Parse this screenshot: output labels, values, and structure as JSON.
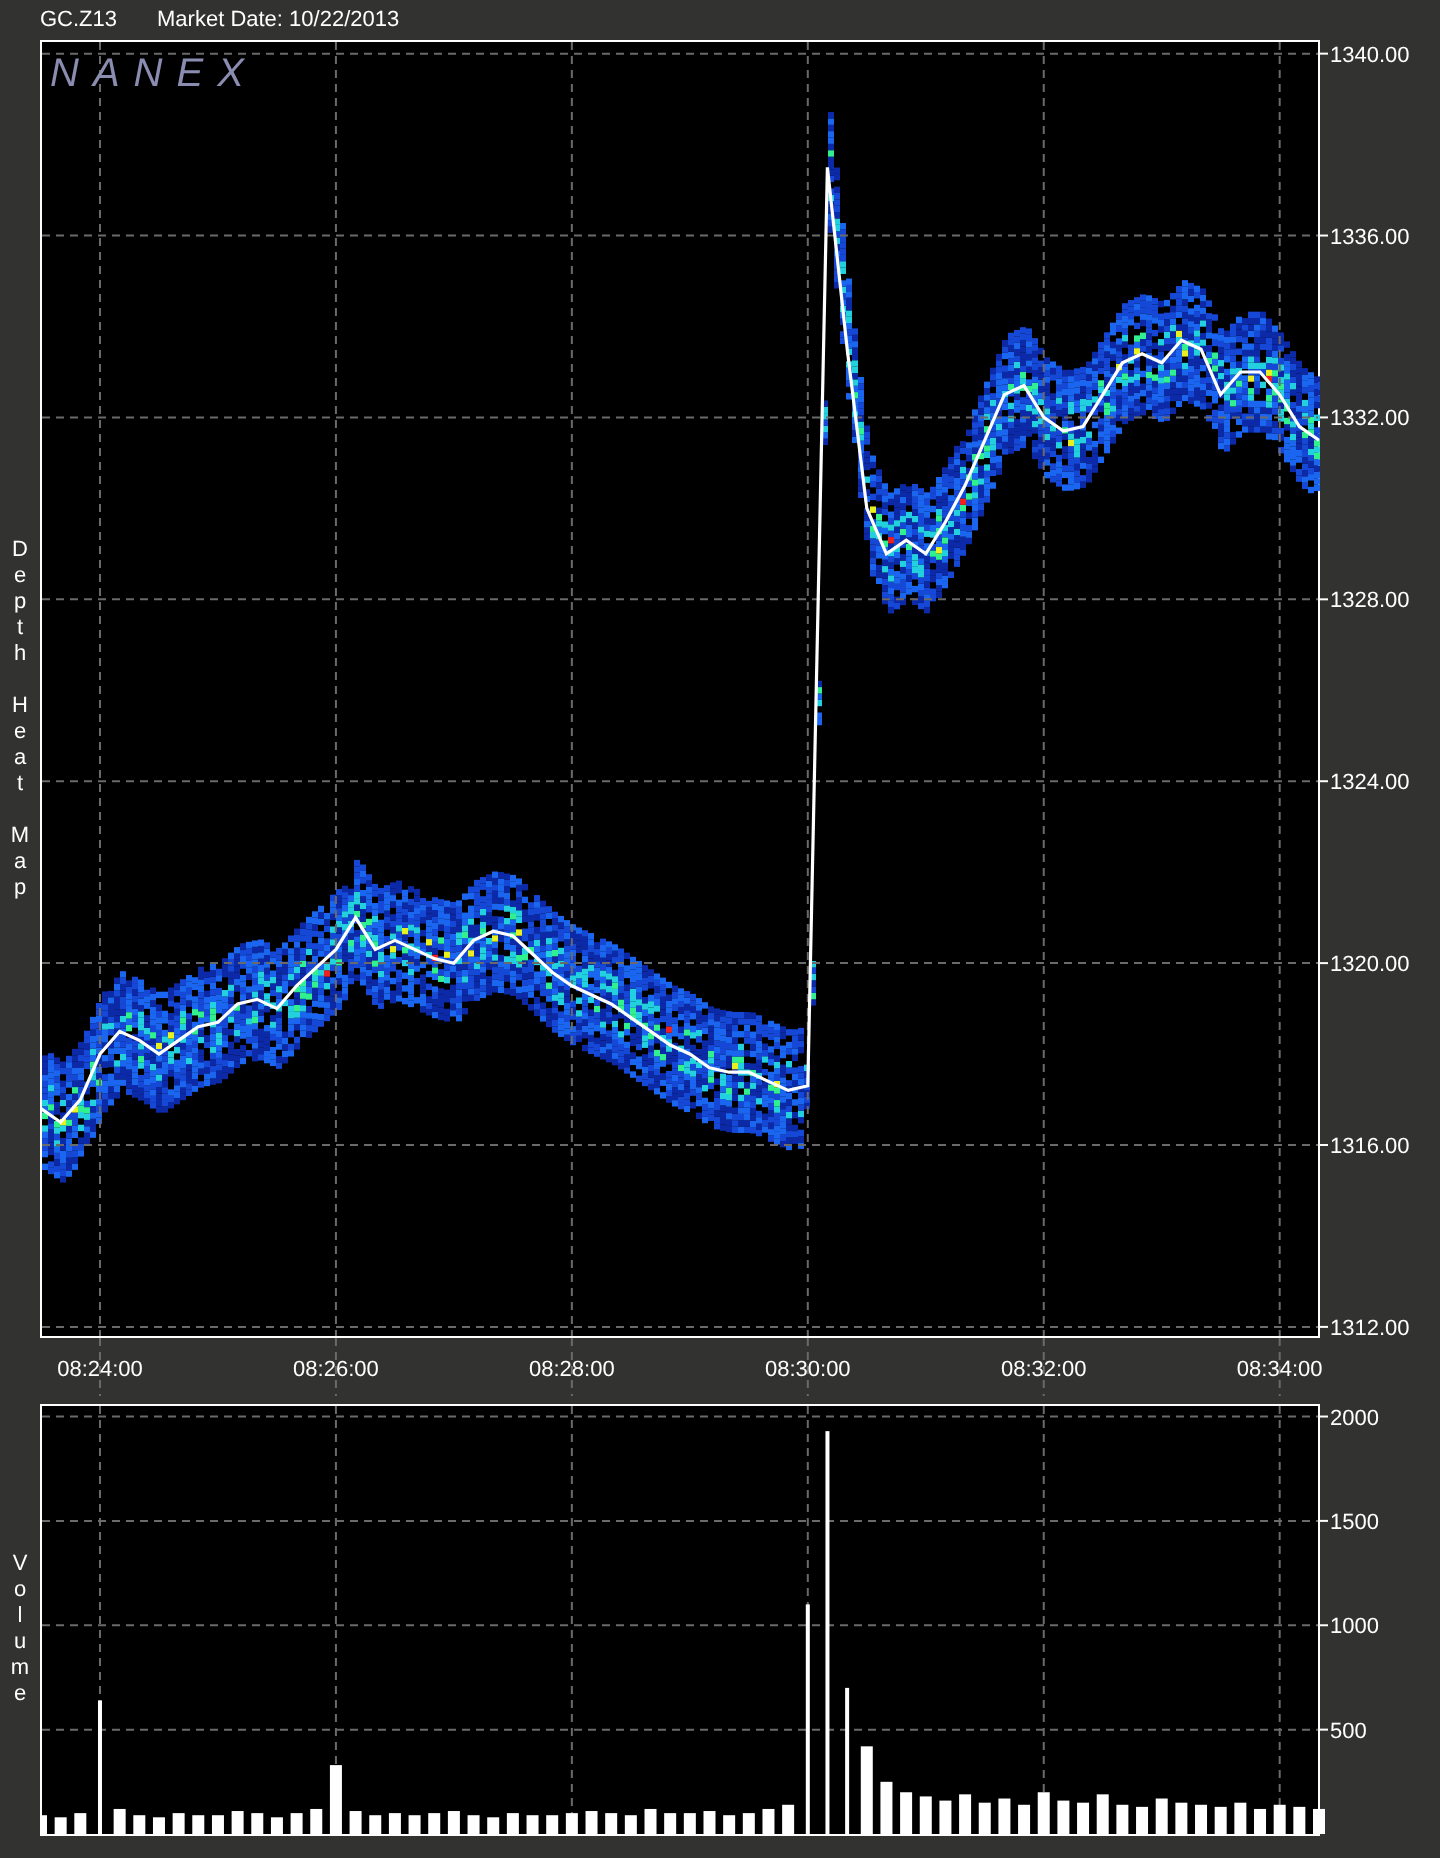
{
  "header": {
    "symbol": "GC.Z13",
    "market_date": "Market Date: 10/22/2013"
  },
  "price_panel": {
    "logo": "NANEX",
    "chart_data": {
      "type": "line",
      "ylabel": "Depth Heat Map",
      "grid": true,
      "ylim": [
        1311.8,
        1340.3
      ],
      "categories": [
        null,
        null,
        null,
        "08:24:00",
        null,
        null,
        null,
        null,
        null,
        null,
        null,
        null,
        null,
        null,
        null,
        "08:26:00",
        null,
        null,
        null,
        null,
        null,
        null,
        null,
        null,
        null,
        null,
        null,
        "08:28:00",
        null,
        null,
        null,
        null,
        null,
        null,
        null,
        null,
        null,
        null,
        null,
        "08:30:00",
        null,
        null,
        null,
        null,
        null,
        null,
        null,
        null,
        null,
        null,
        null,
        "08:32:00",
        null,
        null,
        null,
        null,
        null,
        null,
        null,
        null,
        null,
        null,
        null,
        "08:34:00",
        null,
        null
      ],
      "yticks": [
        {
          "value": 1312,
          "label": "1312.00"
        },
        {
          "value": 1316,
          "label": "1316.00"
        },
        {
          "value": 1320,
          "label": "1320.00"
        },
        {
          "value": 1324,
          "label": "1324.00"
        },
        {
          "value": 1328,
          "label": "1328.00"
        },
        {
          "value": 1332,
          "label": "1332.00"
        },
        {
          "value": 1336,
          "label": "1336.00"
        },
        {
          "value": 1340,
          "label": "1340.00"
        }
      ],
      "series": [
        {
          "color": "#ffffff",
          "values": [
            1316.8,
            1316.5,
            1317.0,
            1318.0,
            1318.5,
            1318.3,
            1318.0,
            1318.3,
            1318.6,
            1318.7,
            1319.1,
            1319.2,
            1319.0,
            1319.5,
            1319.9,
            1320.3,
            1321.0,
            1320.3,
            1320.5,
            1320.3,
            1320.1,
            1320.0,
            1320.5,
            1320.7,
            1320.6,
            1320.2,
            1319.8,
            1319.5,
            1319.3,
            1319.1,
            1318.8,
            1318.5,
            1318.2,
            1318.0,
            1317.7,
            1317.6,
            1317.6,
            1317.4,
            1317.2,
            1317.3,
            1337.5,
            1333.5,
            1330.0,
            1329.0,
            1329.3,
            1329.0,
            1329.7,
            1330.5,
            1331.5,
            1332.5,
            1332.7,
            1332.0,
            1331.7,
            1331.8,
            1332.5,
            1333.2,
            1333.4,
            1333.2,
            1333.7,
            1333.5,
            1332.5,
            1333.0,
            1333.0,
            1332.5,
            1331.8,
            1331.5
          ]
        }
      ]
    }
  },
  "volume_panel": {
    "chart_data": {
      "type": "bar",
      "ylabel": "Volume",
      "grid": true,
      "ylim": [
        0,
        2060
      ],
      "categories": [
        null,
        null,
        null,
        null,
        null,
        null,
        null,
        null,
        null,
        null,
        null,
        null,
        null,
        null,
        null,
        null,
        null,
        null,
        null,
        null,
        null,
        null,
        null,
        null,
        null,
        null,
        null,
        null,
        null,
        null,
        null,
        null,
        null,
        null,
        null,
        null,
        null,
        null,
        null,
        null,
        null,
        null,
        null,
        null,
        null,
        null,
        null,
        null,
        null,
        null,
        null,
        null,
        null,
        null,
        null,
        null,
        null,
        null,
        null,
        null,
        null,
        null,
        null,
        null,
        null,
        null
      ],
      "yticks": [
        {
          "value": 500,
          "label": "500"
        },
        {
          "value": 1000,
          "label": "1000"
        },
        {
          "value": 1500,
          "label": "1500"
        },
        {
          "value": 2000,
          "label": "2000"
        }
      ],
      "series": [
        {
          "color": "#ffffff",
          "values": [
            90,
            80,
            100,
            640,
            120,
            90,
            80,
            100,
            90,
            90,
            110,
            100,
            80,
            100,
            120,
            330,
            110,
            90,
            100,
            90,
            100,
            110,
            90,
            80,
            100,
            90,
            90,
            100,
            110,
            100,
            90,
            120,
            100,
            100,
            110,
            90,
            100,
            120,
            140,
            1100,
            1930,
            700,
            420,
            250,
            200,
            180,
            160,
            190,
            150,
            170,
            140,
            200,
            160,
            150,
            190,
            140,
            130,
            170,
            150,
            140,
            130,
            150,
            120,
            140,
            130,
            120
          ]
        }
      ]
    }
  }
}
